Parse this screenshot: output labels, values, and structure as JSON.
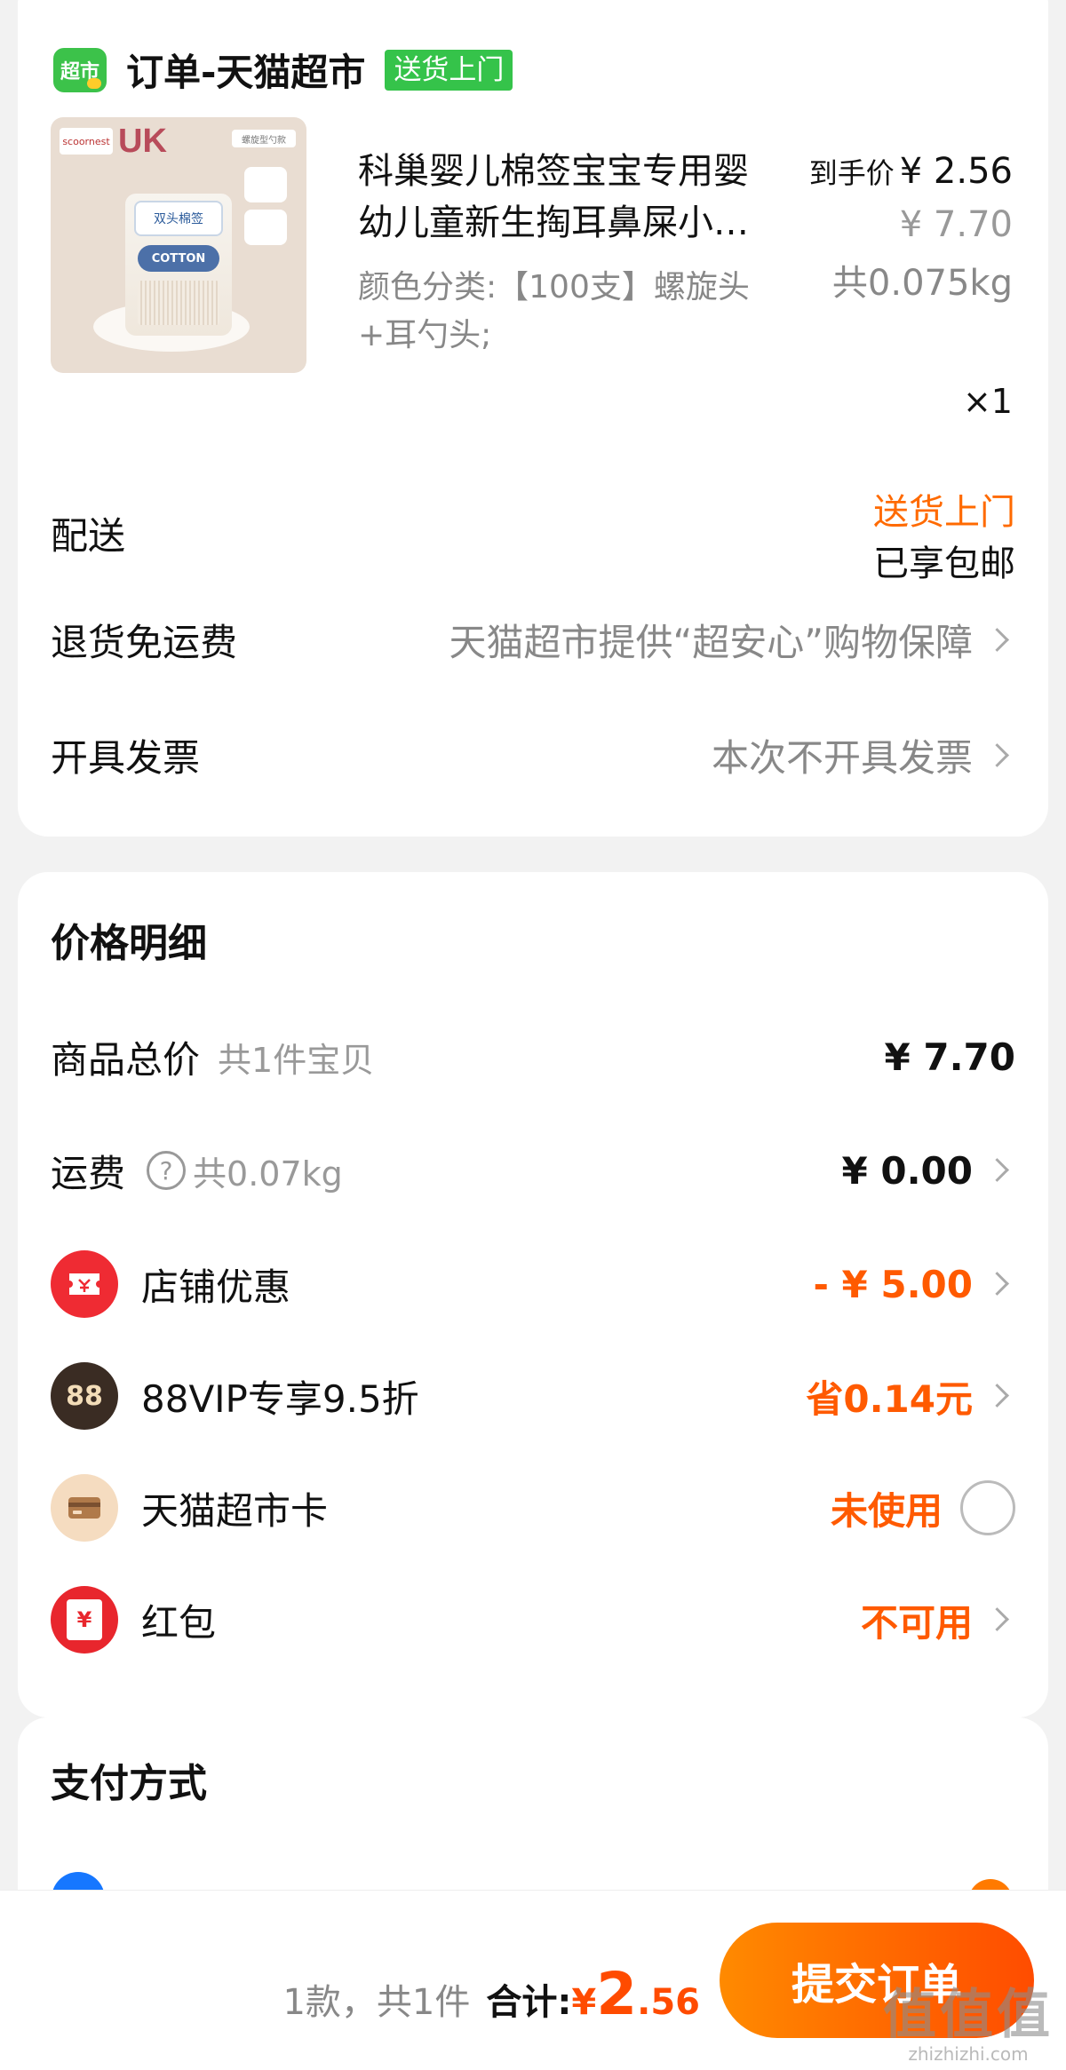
{
  "shop": {
    "logo_text": "超市",
    "name": "订单-天猫超市",
    "tag": "送货上门"
  },
  "product": {
    "title_line1": "科巢婴儿棉签宝宝专用婴",
    "title_line2": "幼儿童新生掏耳鼻屎小…",
    "spec_line1": "颜色分类:【100支】螺旋头",
    "spec_line2": "+耳勺头;",
    "final_price_label": "到手价",
    "final_price": "¥ 2.56",
    "original_price": "¥ 7.70",
    "weight": "共0.075kg",
    "quantity": "×1",
    "image_text": {
      "brand": "scoornest",
      "logo": "UK",
      "tag": "螺旋型勺款",
      "lid": "双头棉签",
      "label": "COTTON"
    }
  },
  "delivery": {
    "label": "配送",
    "method": "送货上门",
    "note": "已享包邮"
  },
  "return_shipping": {
    "label": "退货免运费",
    "value": "天猫超市提供“超安心”购物保障"
  },
  "invoice": {
    "label": "开具发票",
    "value": "本次不开具发票"
  },
  "price_detail": {
    "title": "价格明细",
    "rows": [
      {
        "label": "商品总价",
        "sub": "共1件宝贝",
        "value": "¥ 7.70"
      },
      {
        "label": "运费",
        "sub": "共0.07kg",
        "value": "¥ 0.00",
        "help_icon": "?"
      },
      {
        "label": "店铺优惠",
        "value": "- ¥ 5.00",
        "icon": "coupon-icon"
      },
      {
        "label": "88VIP专享9.5折",
        "value": "省0.14元",
        "icon": "vip-88-icon",
        "icon_text": "88"
      },
      {
        "label": "天猫超市卡",
        "value": "未使用",
        "icon": "card-icon"
      },
      {
        "label": "红包",
        "value": "不可用",
        "icon": "red-packet-icon",
        "icon_text": "¥"
      }
    ]
  },
  "payment": {
    "title": "支付方式"
  },
  "footer": {
    "count": "1款，共1件",
    "total_label": "合计:",
    "currency": "¥",
    "total_int": "2",
    "total_dec": ".56",
    "submit_label": "提交订单"
  },
  "watermark": {
    "big": "值值值",
    "small": "zhizhizhi.com"
  },
  "colors": {
    "accent_orange": "#ff5a00",
    "tmall_green": "#35c34a",
    "page_bg": "#f2f2f2"
  }
}
